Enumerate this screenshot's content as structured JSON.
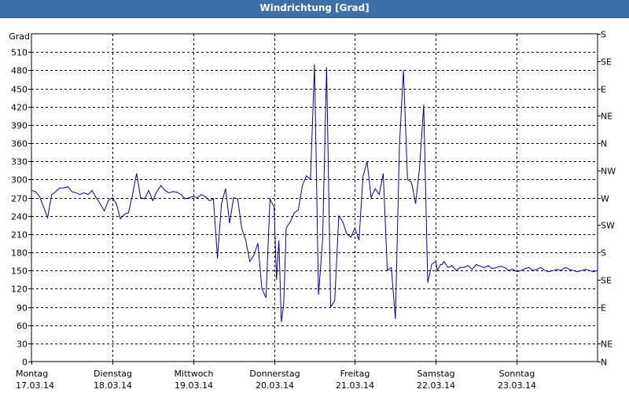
{
  "chart_data": {
    "type": "line",
    "title": "Windrichtung [Grad]",
    "ylabel": "Grad",
    "ylim": [
      0,
      540
    ],
    "yticks": [
      0,
      30,
      60,
      90,
      120,
      150,
      180,
      210,
      240,
      270,
      300,
      330,
      360,
      390,
      420,
      450,
      480,
      510
    ],
    "right_axis_labels": [
      {
        "value": 0,
        "label": "N"
      },
      {
        "value": 30,
        "label": "NE"
      },
      {
        "value": 90,
        "label": "E"
      },
      {
        "value": 135,
        "label": "SE"
      },
      {
        "value": 180,
        "label": "S"
      },
      {
        "value": 225,
        "label": "SW"
      },
      {
        "value": 270,
        "label": "W"
      },
      {
        "value": 315,
        "label": "NW"
      },
      {
        "value": 360,
        "label": "N"
      },
      {
        "value": 405,
        "label": "NE"
      },
      {
        "value": 450,
        "label": "E"
      },
      {
        "value": 495,
        "label": "SE"
      },
      {
        "value": 540,
        "label": "S"
      }
    ],
    "xlim": [
      0,
      7
    ],
    "x_tick_labels": [
      {
        "day": "Montag",
        "date": "17.03.14"
      },
      {
        "day": "Dienstag",
        "date": "18.03.14"
      },
      {
        "day": "Mittwoch",
        "date": "19.03.14"
      },
      {
        "day": "Donnerstag",
        "date": "20.03.14"
      },
      {
        "day": "Freitag",
        "date": "21.03.14"
      },
      {
        "day": "Samstag",
        "date": "22.03.14"
      },
      {
        "day": "Sonntag",
        "date": "23.03.14"
      }
    ],
    "grid": true,
    "series_color": "#0000aa",
    "series": [
      {
        "x": [
          0.0,
          0.05,
          0.1,
          0.15,
          0.2,
          0.25,
          0.3,
          0.35,
          0.4,
          0.45,
          0.5,
          0.55,
          0.6,
          0.65,
          0.7,
          0.75,
          0.8,
          0.85,
          0.9,
          0.95,
          1.0,
          1.05,
          1.1,
          1.15,
          1.2,
          1.25,
          1.3,
          1.35,
          1.4,
          1.45,
          1.5,
          1.55,
          1.6,
          1.65,
          1.7,
          1.75,
          1.8,
          1.85,
          1.9,
          1.95,
          2.0,
          2.05,
          2.1,
          2.15,
          2.2,
          2.25,
          2.3,
          2.35,
          2.4,
          2.45,
          2.5,
          2.55,
          2.6,
          2.65,
          2.7,
          2.75,
          2.8,
          2.85,
          2.9,
          2.95,
          3.0,
          3.03,
          3.06,
          3.09,
          3.12,
          3.15,
          3.2,
          3.25,
          3.3,
          3.35,
          3.4,
          3.45,
          3.5,
          3.55,
          3.6,
          3.65,
          3.7,
          3.75,
          3.8,
          3.85,
          3.9,
          3.95,
          4.0,
          4.05,
          4.1,
          4.15,
          4.2,
          4.25,
          4.3,
          4.35,
          4.4,
          4.45,
          4.5,
          4.55,
          4.6,
          4.65,
          4.7,
          4.75,
          4.8,
          4.85,
          4.9,
          4.95,
          5.0,
          5.02,
          5.04,
          5.06,
          5.08,
          5.1,
          5.15,
          5.2,
          5.25,
          5.3,
          5.35,
          5.4,
          5.45,
          5.5,
          5.55,
          5.6,
          5.65,
          5.7,
          5.75,
          5.8,
          5.85,
          5.9,
          5.95,
          6.0,
          6.05,
          6.1,
          6.15,
          6.2,
          6.25,
          6.3,
          6.35,
          6.4,
          6.45,
          6.5,
          6.55,
          6.6,
          6.65,
          6.7,
          6.75,
          6.8,
          6.85,
          6.9,
          6.95,
          7.0
        ],
        "values": [
          282,
          280,
          272,
          255,
          237,
          275,
          280,
          286,
          286,
          288,
          280,
          278,
          275,
          278,
          275,
          282,
          270,
          260,
          248,
          265,
          270,
          260,
          235,
          243,
          245,
          275,
          310,
          270,
          268,
          282,
          265,
          280,
          290,
          282,
          278,
          280,
          279,
          275,
          268,
          270,
          272,
          270,
          275,
          272,
          265,
          268,
          170,
          260,
          285,
          228,
          270,
          268,
          220,
          200,
          165,
          175,
          195,
          120,
          105,
          268,
          255,
          135,
          200,
          65,
          95,
          220,
          230,
          245,
          250,
          290,
          306,
          300,
          490,
          110,
          200,
          485,
          90,
          100,
          240,
          230,
          210,
          205,
          220,
          200,
          305,
          330,
          270,
          285,
          275,
          310,
          150,
          155,
          70,
          355,
          480,
          300,
          295,
          260,
          320,
          423,
          130,
          160,
          165,
          150,
          155,
          160,
          160,
          165,
          155,
          158,
          150,
          155,
          155,
          158,
          152,
          160,
          157,
          155,
          158,
          153,
          155,
          157,
          155,
          150,
          152,
          148,
          150,
          153,
          155,
          150,
          152,
          155,
          150,
          148,
          150,
          152,
          150,
          155,
          152,
          150,
          148,
          150,
          152,
          150,
          148,
          150
        ]
      }
    ]
  }
}
